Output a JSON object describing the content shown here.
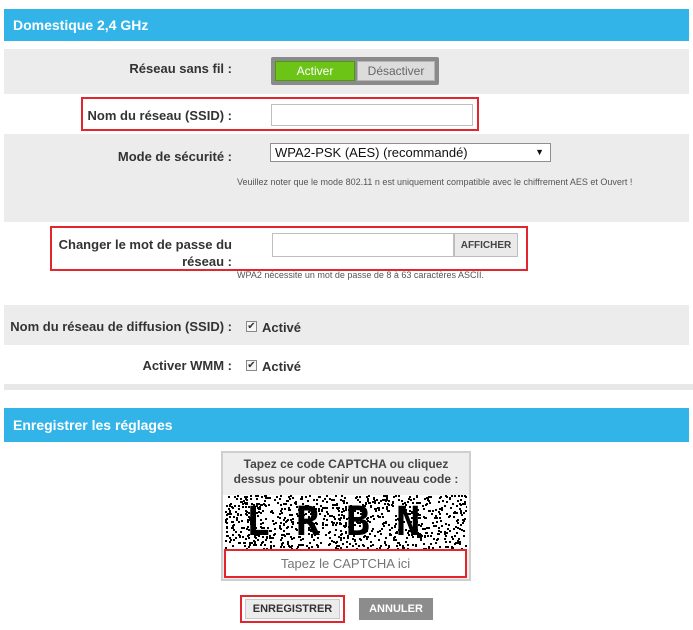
{
  "wifi_section": {
    "title": "Domestique 2,4 GHz",
    "wireless_network": {
      "label": "Réseau sans fil :",
      "enable_label": "Activer",
      "disable_label": "Désactiver"
    },
    "ssid": {
      "label": "Nom du réseau (SSID) :",
      "value": ""
    },
    "security_mode": {
      "label": "Mode de sécurité :",
      "selected": "WPA2-PSK (AES) (recommandé)",
      "note": "Veuillez noter que le mode 802.11 n est uniquement compatible avec le chiffrement AES et Ouvert !"
    },
    "password": {
      "label": "Changer le mot de passe du réseau :",
      "value": "",
      "show_button": "AFFICHER",
      "hint": "WPA2 nécessite un mot de passe de 8 à 63 caractères ASCII."
    },
    "broadcast_ssid": {
      "label": "Nom du réseau de diffusion (SSID) :",
      "checkbox_label": "Activé"
    },
    "wmm": {
      "label": "Activer WMM :",
      "checkbox_label": "Activé"
    }
  },
  "save_section": {
    "title": "Enregistrer les réglages",
    "captcha": {
      "instructions": "Tapez ce code CAPTCHA ou cliquez dessus pour obtenir un nouveau code :",
      "image_text": "LRBN",
      "input_placeholder": "Tapez le CAPTCHA ici"
    },
    "save_button": "ENREGISTRER",
    "cancel_button": "ANNULER"
  },
  "colors": {
    "header": "#33b4e8",
    "enable_green": "#6cc417",
    "highlight_red": "#e3252d",
    "row_gray": "#ececec"
  }
}
